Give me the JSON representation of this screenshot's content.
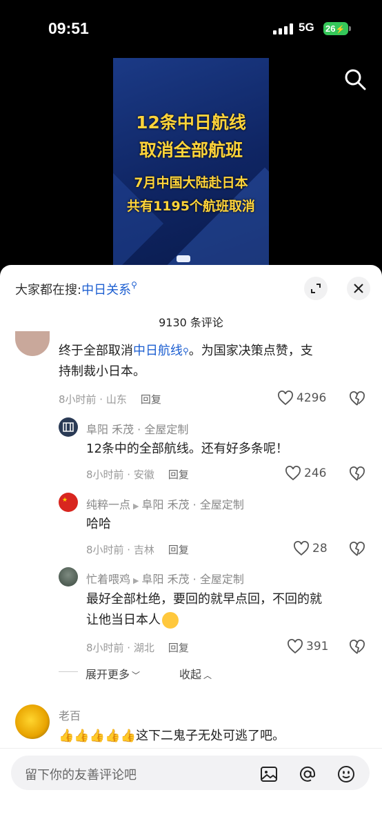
{
  "status_bar": {
    "time": "09:51",
    "network": "5G",
    "battery": "26"
  },
  "video": {
    "line1": "12条中日航线",
    "line2": "取消全部航班",
    "line3": "7月中国大陆赴日本",
    "line4": "共有1195个航班取消"
  },
  "search": {
    "prefix": "大家都在搜:",
    "term": "中日关系"
  },
  "comments_header": {
    "count_label": "9130 条评论"
  },
  "comments": [
    {
      "text_before": "终于全部取消",
      "link": "中日航线",
      "text_after": "。为国家决策点赞，支",
      "text_line2": "持制裁小日本。",
      "time_location": "8小时前 · 山东",
      "reply_label": "回复",
      "likes": "4296"
    }
  ],
  "replies": [
    {
      "user": "阜阳 禾茂 · 全屋定制",
      "text": "12条中的全部航线。还有好多条呢！",
      "time_location": "8小时前 · 安徽",
      "reply_label": "回复",
      "likes": "246"
    },
    {
      "user": "纯粹一点",
      "reply_to": "阜阳 禾茂 · 全屋定制",
      "text": "哈哈",
      "time_location": "8小时前 · 吉林",
      "reply_label": "回复",
      "likes": "28"
    },
    {
      "user": "忙着喂鸡",
      "reply_to": "阜阳 禾茂 · 全屋定制",
      "text_line1": "最好全部杜绝，要回的就早点回，不回的就",
      "text_line2": "让他当日本人",
      "time_location": "8小时前 · 湖北",
      "reply_label": "回复",
      "likes": "391"
    }
  ],
  "expand": {
    "more_label": "展开更多",
    "collapse_label": "收起"
  },
  "next_comment": {
    "user": "老百",
    "emoji": "👍👍👍👍👍",
    "text": "这下二鬼子无处可逃了吧。"
  },
  "input": {
    "placeholder": "留下你的友善评论吧"
  },
  "colors": {
    "link": "#1d5fd1",
    "video_text": "#ffd43a",
    "video_bg": "#1b3a86"
  }
}
